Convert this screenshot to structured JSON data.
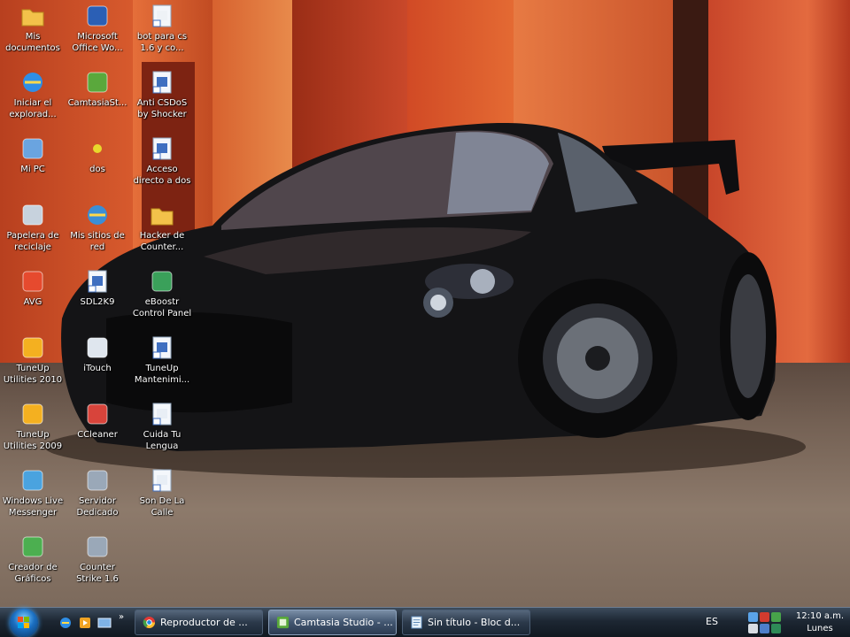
{
  "desktop": {
    "icons": [
      {
        "label": "Mis\ndocumentos",
        "icon": "folder-icon"
      },
      {
        "label": "Iniciar el\nexplorad...",
        "icon": "internet-explorer-icon"
      },
      {
        "label": "Mi PC",
        "icon": "computer-icon"
      },
      {
        "label": "Papelera de\nreciclaje",
        "icon": "recycle-bin-icon"
      },
      {
        "label": "AVG",
        "icon": "avg-icon"
      },
      {
        "label": "TuneUp\nUtilities 2010",
        "icon": "tuneup-icon"
      },
      {
        "label": "TuneUp\nUtilities 2009",
        "icon": "tuneup-icon"
      },
      {
        "label": "Windows Live\nMessenger",
        "icon": "messenger-icon"
      },
      {
        "label": "Creador de\nGráficos",
        "icon": "chart-icon"
      },
      {
        "label": "Microsoft\nOffice Wo...",
        "icon": "word-icon"
      },
      {
        "label": "CamtasiaSt...",
        "icon": "camtasia-icon"
      },
      {
        "label": "dos",
        "icon": "dot-icon"
      },
      {
        "label": "Mis sitios de\nred",
        "icon": "network-icon"
      },
      {
        "label": "SDL2K9",
        "icon": "shortcut-icon"
      },
      {
        "label": "iTouch",
        "icon": "itouch-icon"
      },
      {
        "label": "CCleaner",
        "icon": "ccleaner-icon"
      },
      {
        "label": "Servidor\nDedicado",
        "icon": "counter-strike-icon"
      },
      {
        "label": "Counter\nStrike 1.6",
        "icon": "counter-strike-icon"
      },
      {
        "label": "bot para cs\n1.6 y co...",
        "icon": "text-file-icon"
      },
      {
        "label": "Anti CSDoS\nby Shocker",
        "icon": "shortcut-icon"
      },
      {
        "label": "Acceso\ndirecto a dos",
        "icon": "shortcut-icon"
      },
      {
        "label": "Hacker de\nCounter...",
        "icon": "folder-icon"
      },
      {
        "label": "eBoostr\nControl Panel",
        "icon": "eboostr-icon"
      },
      {
        "label": "TuneUp\nMantenimi...",
        "icon": "shortcut-icon"
      },
      {
        "label": "Cuida Tu\nLengua",
        "icon": "document-icon"
      },
      {
        "label": "Son De La\nCalle",
        "icon": "document-icon"
      }
    ]
  },
  "taskbar": {
    "start": "start-orb",
    "quicklaunch": [
      "internet-explorer-icon",
      "media-player-icon",
      "show-desktop-icon"
    ],
    "tasks": [
      {
        "label": "Reproductor de ...",
        "icon": "chrome-icon"
      },
      {
        "label": "Camtasia Studio - ...",
        "icon": "camtasia-icon"
      },
      {
        "label": "Sin título - Bloc d...",
        "icon": "notepad-icon"
      }
    ],
    "language": "ES",
    "clock_time": "12:10 a.m.",
    "clock_day": "Lunes"
  },
  "colors": {
    "wall_orange": "#d9572b",
    "wall_dark": "#8f2a16",
    "taskbar": "#1d2733",
    "car_body": "#141416"
  }
}
